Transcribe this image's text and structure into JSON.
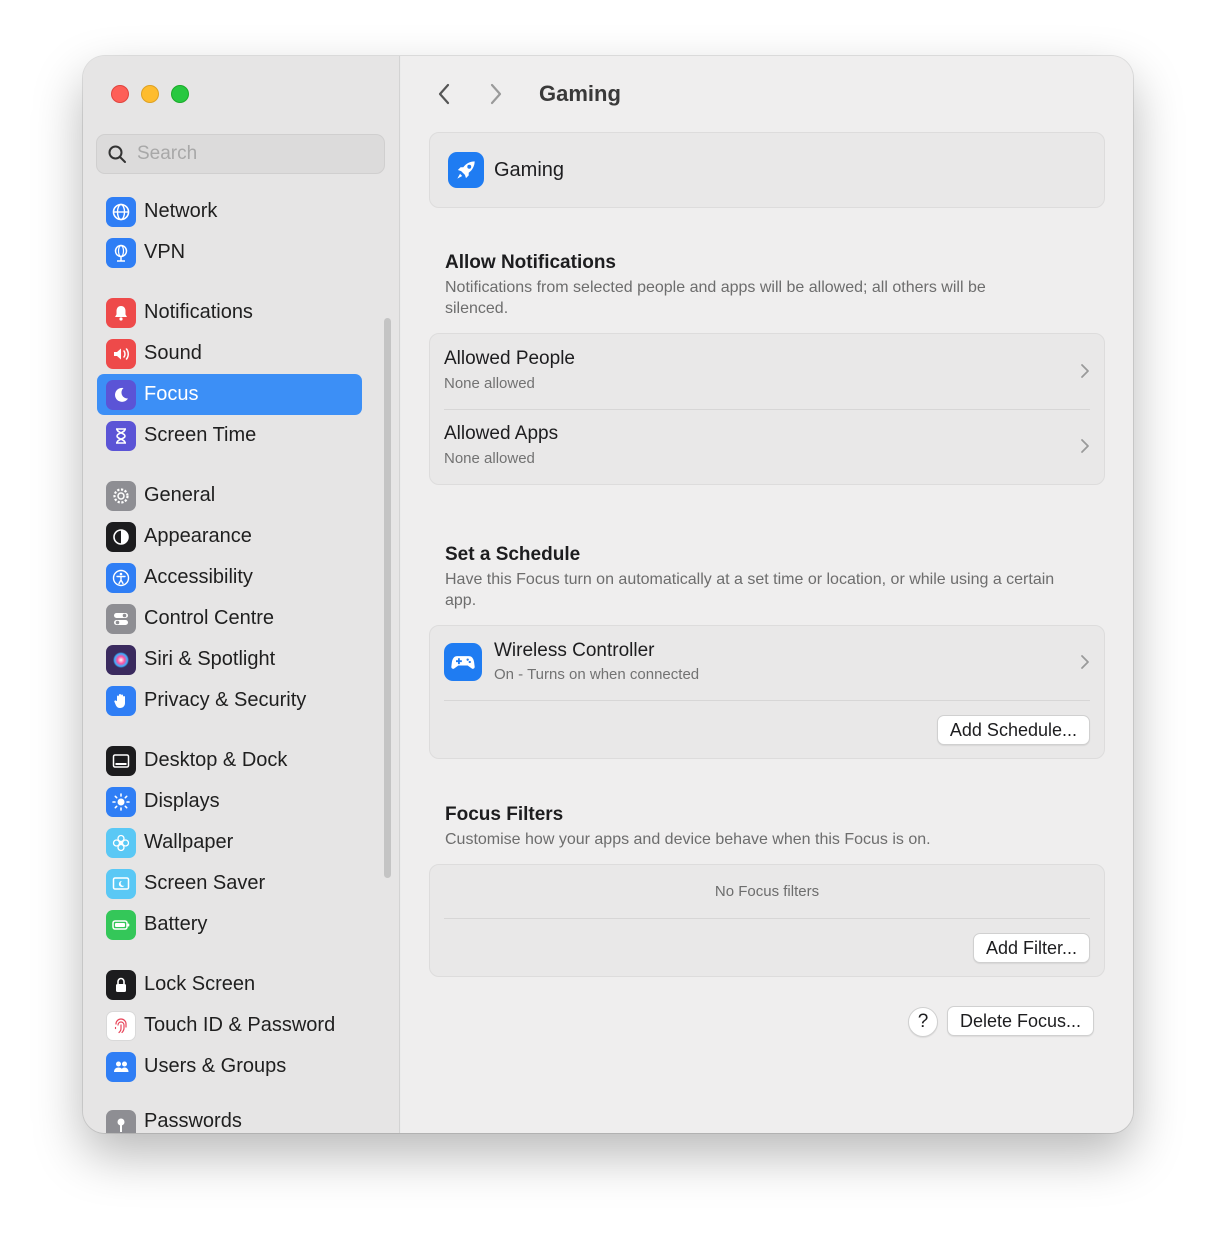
{
  "sidebar": {
    "search_placeholder": "Search",
    "groups": [
      [
        {
          "label": "Network",
          "icon": "globe-icon",
          "color": "#2f7ef5"
        },
        {
          "label": "VPN",
          "icon": "vpn-globe-icon",
          "color": "#2f7ef5"
        }
      ],
      [
        {
          "label": "Notifications",
          "icon": "bell-icon",
          "color": "#ee4a4a"
        },
        {
          "label": "Sound",
          "icon": "speaker-icon",
          "color": "#ee4a4a"
        },
        {
          "label": "Focus",
          "icon": "moon-icon",
          "color": "#5b54d6",
          "active": true
        },
        {
          "label": "Screen Time",
          "icon": "hourglass-icon",
          "color": "#5b54d6"
        }
      ],
      [
        {
          "label": "General",
          "icon": "gear-icon",
          "color": "#8e8e93"
        },
        {
          "label": "Appearance",
          "icon": "appearance-icon",
          "color": "#1c1c1e"
        },
        {
          "label": "Accessibility",
          "icon": "accessibility-icon",
          "color": "#2f7ef5"
        },
        {
          "label": "Control Centre",
          "icon": "toggles-icon",
          "color": "#8e8e93"
        },
        {
          "label": "Siri & Spotlight",
          "icon": "siri-icon",
          "color": "#3a2a5e"
        },
        {
          "label": "Privacy & Security",
          "icon": "hand-icon",
          "color": "#2f7ef5"
        }
      ],
      [
        {
          "label": "Desktop & Dock",
          "icon": "dock-icon",
          "color": "#1c1c1e"
        },
        {
          "label": "Displays",
          "icon": "sun-icon",
          "color": "#2f7ef5"
        },
        {
          "label": "Wallpaper",
          "icon": "flower-icon",
          "color": "#5ac8f5"
        },
        {
          "label": "Screen Saver",
          "icon": "screensaver-icon",
          "color": "#5ac8f5"
        },
        {
          "label": "Battery",
          "icon": "battery-icon",
          "color": "#34c759"
        }
      ],
      [
        {
          "label": "Lock Screen",
          "icon": "lock-icon",
          "color": "#1c1c1e"
        },
        {
          "label": "Touch ID & Password",
          "icon": "fingerprint-icon",
          "color": "#ffffff"
        },
        {
          "label": "Users & Groups",
          "icon": "users-icon",
          "color": "#2f7ef5"
        }
      ],
      [
        {
          "label": "Passwords",
          "icon": "key-icon",
          "color": "#8e8e93"
        }
      ]
    ]
  },
  "main": {
    "title": "Gaming",
    "focus_name": "Gaming",
    "allow_notifications": {
      "title": "Allow Notifications",
      "description": "Notifications from selected people and apps will be allowed; all others will be silenced.",
      "rows": [
        {
          "title": "Allowed People",
          "subtitle": "None allowed"
        },
        {
          "title": "Allowed Apps",
          "subtitle": "None allowed"
        }
      ]
    },
    "schedule": {
      "title": "Set a Schedule",
      "description": "Have this Focus turn on automatically at a set time or location, or while using a certain app.",
      "item_title": "Wireless Controller",
      "item_subtitle": "On - Turns on when connected",
      "add_button": "Add Schedule..."
    },
    "filters": {
      "title": "Focus Filters",
      "description": "Customise how your apps and device behave when this Focus is on.",
      "empty_text": "No Focus filters",
      "add_button": "Add Filter..."
    },
    "help_label": "?",
    "delete_button": "Delete Focus..."
  },
  "colors": {
    "accent": "#3c8ff6",
    "app_icon": "#1f7cf2"
  }
}
